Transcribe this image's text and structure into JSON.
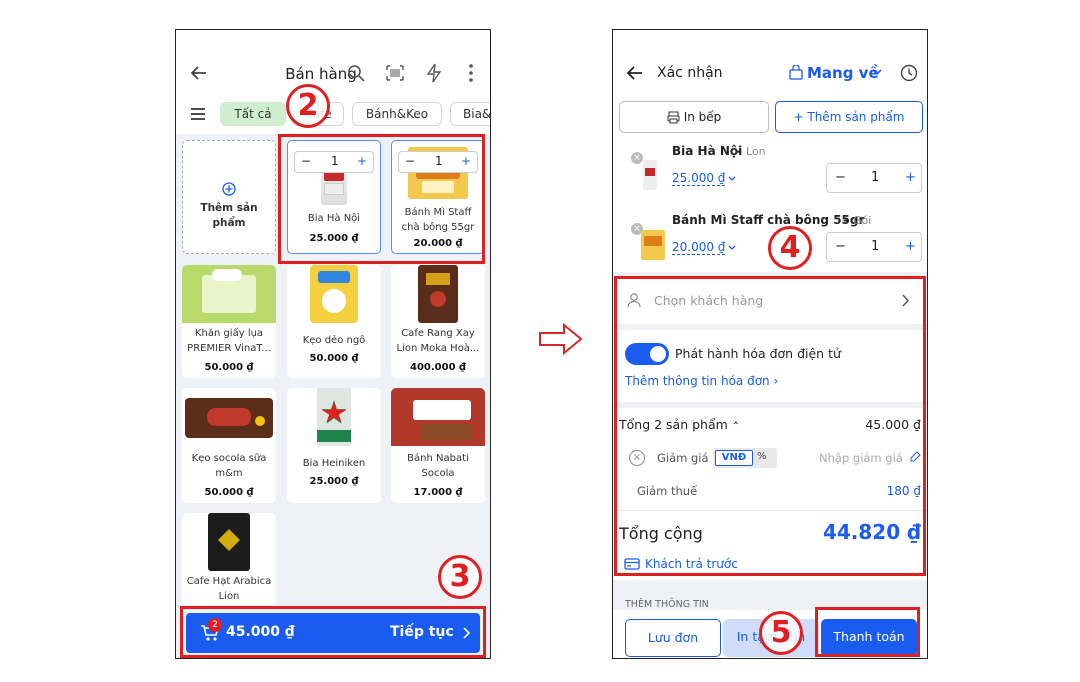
{
  "screen1": {
    "title": "Bán hàng",
    "categories": [
      "Tất cả",
      "Cafe",
      "Bánh&Keo",
      "Bia&"
    ],
    "add_product_label": "Thêm sản phẩm",
    "products": [
      {
        "name": "Bia Hà Nội",
        "price": "25.000 ₫",
        "qty": "1"
      },
      {
        "name": "Bánh Mì Staff chà bông 55gr",
        "price": "20.000 ₫",
        "qty": "1"
      },
      {
        "name": "Khăn giấy lụa PREMIER VinaT...",
        "price": "50.000 ₫"
      },
      {
        "name": "Kẹo dẻo ngô",
        "price": "50.000 ₫"
      },
      {
        "name": "Cafe Rang Xay Lion Moka Hoà...",
        "price": "400.000 ₫"
      },
      {
        "name": "Kẹo socola sữa m&m",
        "price": "50.000 ₫"
      },
      {
        "name": "Bia Heiniken",
        "price": "25.000 ₫"
      },
      {
        "name": "Bánh Nabati Socola",
        "price": "17.000 ₫"
      },
      {
        "name": "Cafe Hạt Arabica Lion",
        "price": ""
      }
    ],
    "cart_badge": "2",
    "cart_total": "45.000 ₫",
    "continue_label": "Tiếp tục"
  },
  "screen2": {
    "title": "Xác nhận",
    "order_type": "Mang về",
    "print_kitchen": "In bếp",
    "add_product": "Thêm sản phẩm",
    "items": [
      {
        "name": "Bia Hà Nội",
        "unit": "Lon",
        "price": "25.000 ₫",
        "qty": "1"
      },
      {
        "name": "Bánh Mì Staff chà bông 55gr",
        "unit": "Gói",
        "price": "20.000 ₫",
        "qty": "1"
      }
    ],
    "customer_placeholder": "Chọn khách hàng",
    "einvoice_label": "Phát hành hóa đơn điện tử",
    "einvoice_info": "Thêm thông tin hóa đơn",
    "subtotal_label": "Tổng 2 sản phẩm",
    "subtotal_value": "45.000 ₫",
    "discount_label": "Giảm giá",
    "discount_unit_vnd": "VNĐ",
    "discount_unit_pct": "%",
    "discount_placeholder": "Nhập giảm giá",
    "tax_discount_label": "Giảm thuế",
    "tax_discount_value": "180 ₫",
    "total_label": "Tổng cộng",
    "total_value": "44.820 ₫",
    "prepaid_label": "Khách trả trước",
    "more_info_label": "THÊM THÔNG TIN",
    "save_button": "Lưu đơn",
    "print_temp_button": "In tạm tính",
    "pay_button": "Thanh toán"
  },
  "markers": [
    "2",
    "3",
    "4",
    "5"
  ],
  "colors": {
    "primary": "#1a5cf0",
    "highlight": "#e02020",
    "chip_active": "#cfeecf"
  }
}
